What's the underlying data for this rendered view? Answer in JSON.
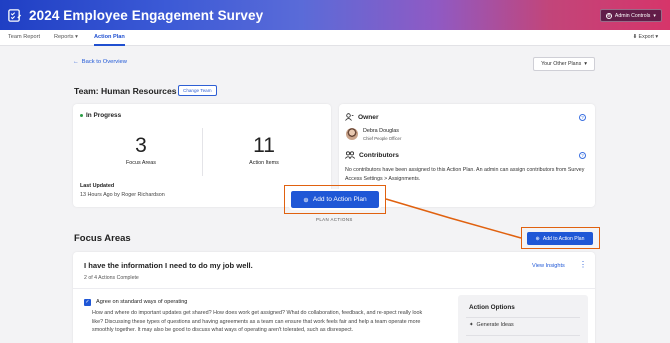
{
  "header": {
    "title": "2024 Employee Engagement Survey",
    "admin_label": "Admin Controls",
    "gradient_start": "#1f3fc4",
    "gradient_end": "#d6356a"
  },
  "tabs": [
    {
      "label": "Team Report"
    },
    {
      "label": "Reports"
    },
    {
      "label": "Action Plan"
    }
  ],
  "export_label": "Export",
  "back_link": "Back to Overview",
  "other_plans": "Your Other Plans",
  "team": {
    "title": "Team: Human Resources",
    "change_label": "Change Team"
  },
  "summary": {
    "status": "In Progress",
    "focus_areas_count": "3",
    "focus_areas_label": "Focus Areas",
    "action_items_count": "11",
    "action_items_label": "Action Items",
    "last_updated_title": "Last Updated",
    "last_updated_value": "13 Hours Ago by Roger Richardson"
  },
  "owner": {
    "heading": "Owner",
    "name": "Debra Douglas",
    "role": "Chief People Officer"
  },
  "contributors": {
    "heading": "Contributors",
    "text": "No contributors have been assigned to this Action Plan. An admin can assign contributors from Survey Access Settings > Assignments."
  },
  "plan_actions": {
    "button_label": "Add to Action Plan",
    "caption": "PLAN ACTIONS"
  },
  "focus_areas": {
    "heading": "Focus Areas",
    "button_label": "Add to Action Plan",
    "item": {
      "title": "I have the information I need to do my job well.",
      "progress": "2 of 4 Actions Complete",
      "view_insights": "View Insights",
      "action_title": "Agree on standard ways of operating",
      "action_desc": "How and where do important updates get shared? How does work get assigned? What do collaboration, feedback, and re-spect really look like? Discussing these types of questions and having agreements as a team can ensure that work feels fair and help a team operate more smoothly together. It may also be good to discuss what ways of operating aren't tolerated, such as disrespect.",
      "options_title": "Action Options",
      "options_item": "Generate Ideas"
    }
  },
  "colors": {
    "accent": "#1f57d6",
    "highlight": "#e0610f",
    "status_green": "#2a9d45"
  }
}
